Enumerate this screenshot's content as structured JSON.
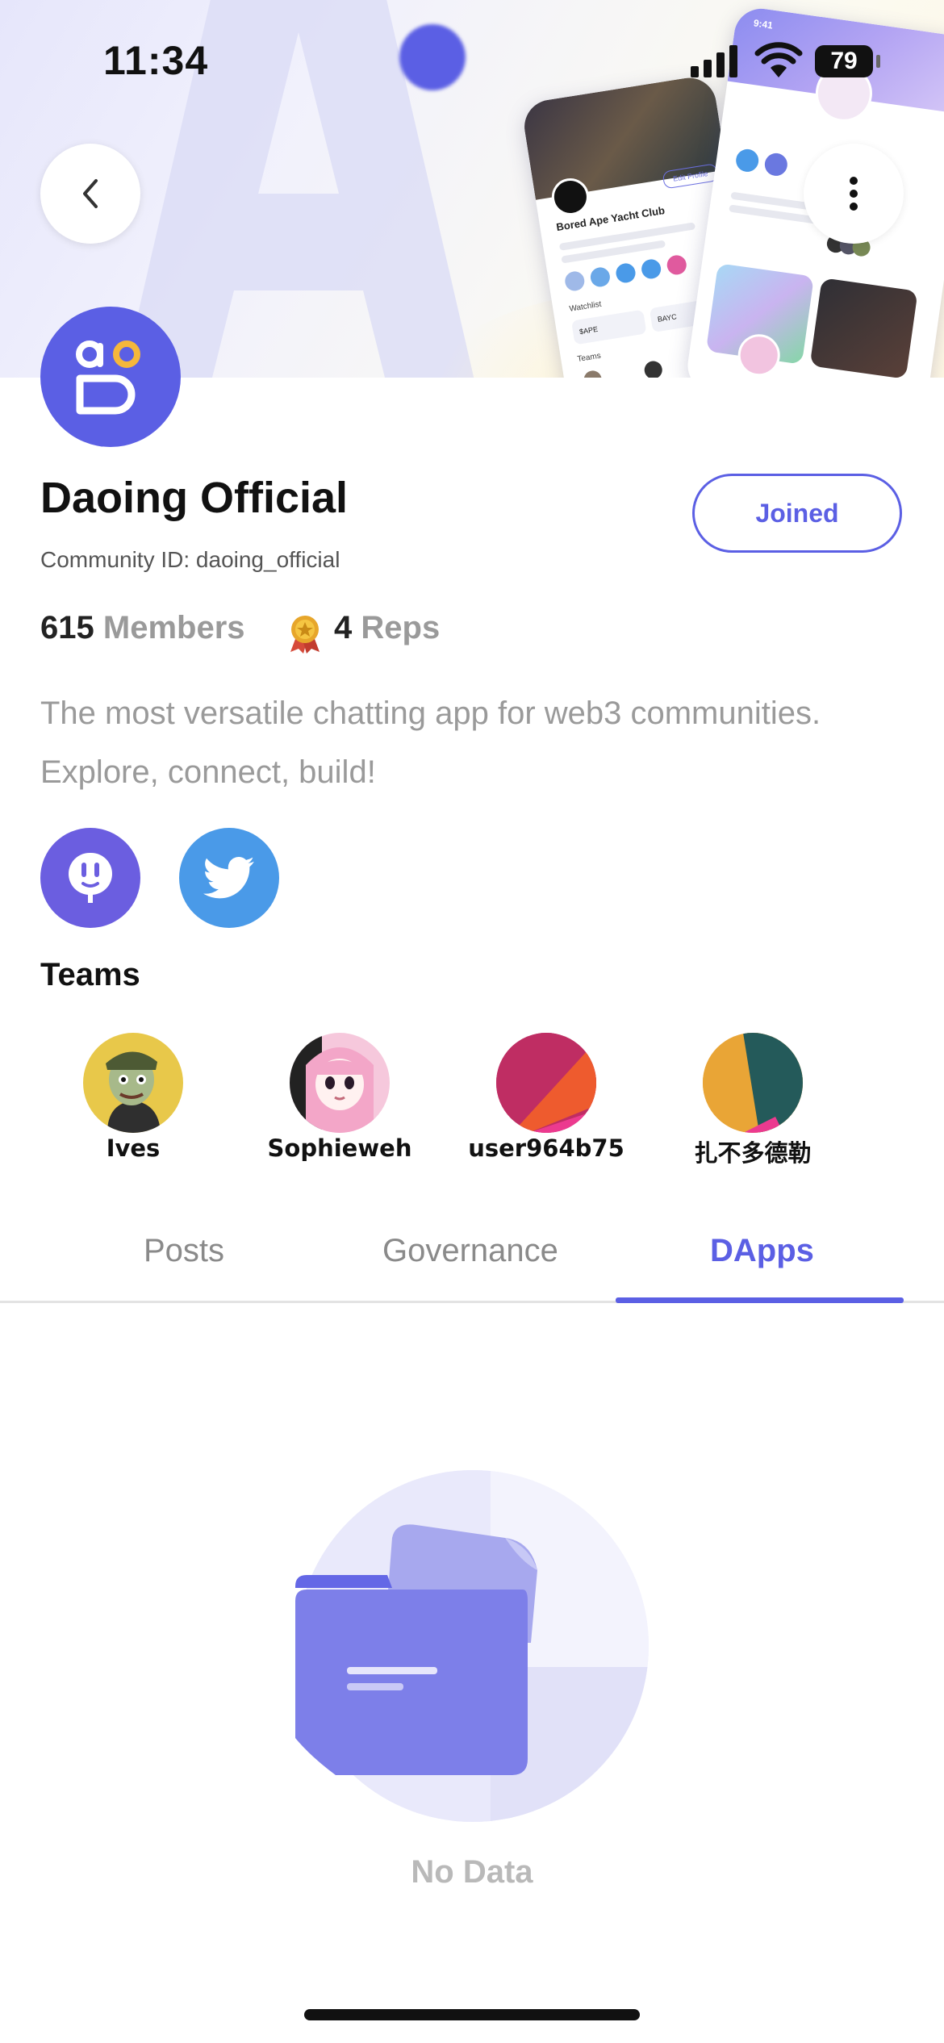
{
  "status_bar": {
    "time": "11:34",
    "battery": "79"
  },
  "community": {
    "name": "Daoing Official",
    "id_text": "Community ID: daoing_official",
    "members_count": "615",
    "members_label": "Members",
    "reps_count": "4",
    "reps_label": "Reps",
    "description": "The most versatile chatting app for web3 communities. Explore, connect, build!",
    "join_button": "Joined"
  },
  "teams": {
    "title": "Teams",
    "members": [
      {
        "name": "Ives"
      },
      {
        "name": "Sophieweh"
      },
      {
        "name": "user964b75"
      },
      {
        "name": "扎不多德勒"
      }
    ]
  },
  "tabs": {
    "items": [
      "Posts",
      "Governance",
      "DApps"
    ],
    "active": "DApps"
  },
  "empty_state": {
    "text": "No Data"
  },
  "mockup": {
    "community_name": "Bored Ape Yacht Club",
    "edit_button": "Edit Profile",
    "watchlist_label": "Watchlist",
    "teams_label": "Teams",
    "coin_label": "$APE",
    "nft_label": "BAYC",
    "phone_time": "9:41"
  },
  "colors": {
    "accent": "#5b5fe4",
    "twitter": "#4a9ae8",
    "voice": "#6b5ee0"
  }
}
